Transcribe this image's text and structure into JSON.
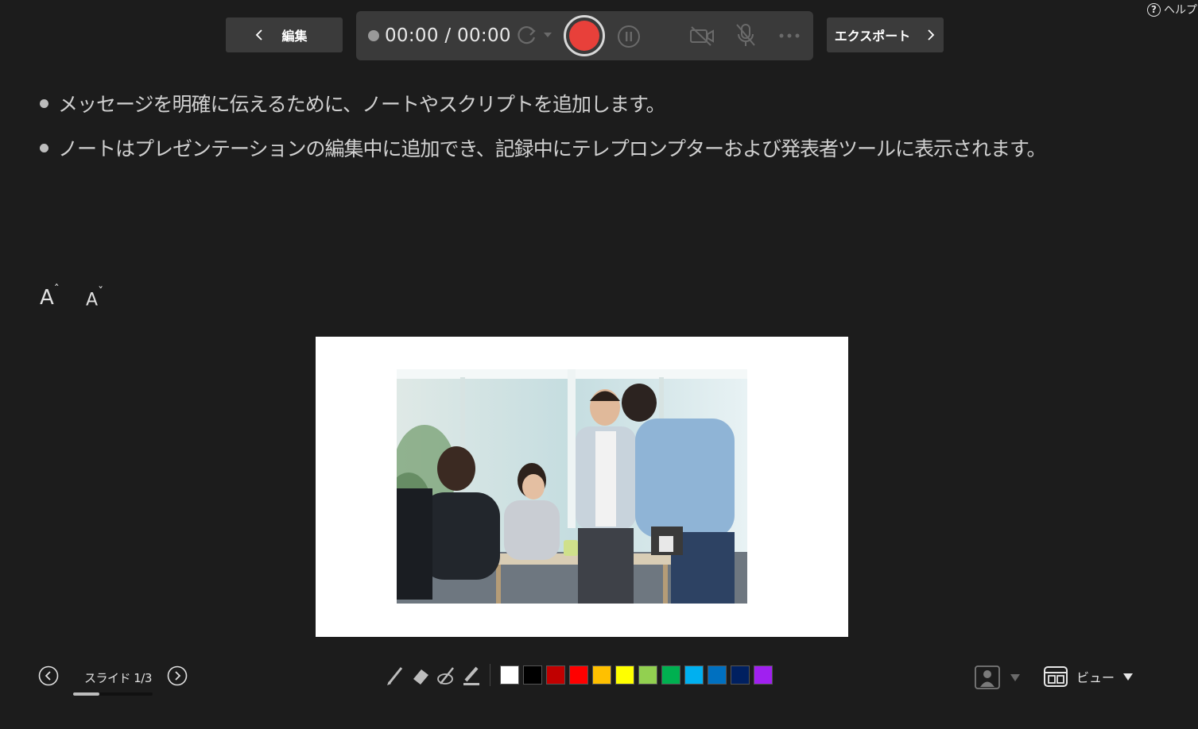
{
  "help": {
    "label": "ヘルプ"
  },
  "topbar": {
    "edit_label": "編集",
    "timer": "00:00 / 00:00",
    "export_label": "エクスポート"
  },
  "notes": [
    "メッセージを明確に伝えるために、ノートやスクリプトを追加します。",
    "ノートはプレゼンテーションの編集中に追加でき、記録中にテレプロンプターおよび発表者ツールに表示されます。"
  ],
  "font_controls": {
    "increase": "A",
    "decrease": "A"
  },
  "slide_nav": {
    "label": "スライド 1/3",
    "current": 1,
    "total": 3
  },
  "colors": {
    "accent_record": "#e8403a",
    "swatches": [
      "#ffffff",
      "#000000",
      "#c00000",
      "#ff0000",
      "#ffc000",
      "#ffff00",
      "#92d050",
      "#00b050",
      "#00b0f0",
      "#0070c0",
      "#002060",
      "#a020f0"
    ]
  },
  "view": {
    "label": "ビュー"
  }
}
